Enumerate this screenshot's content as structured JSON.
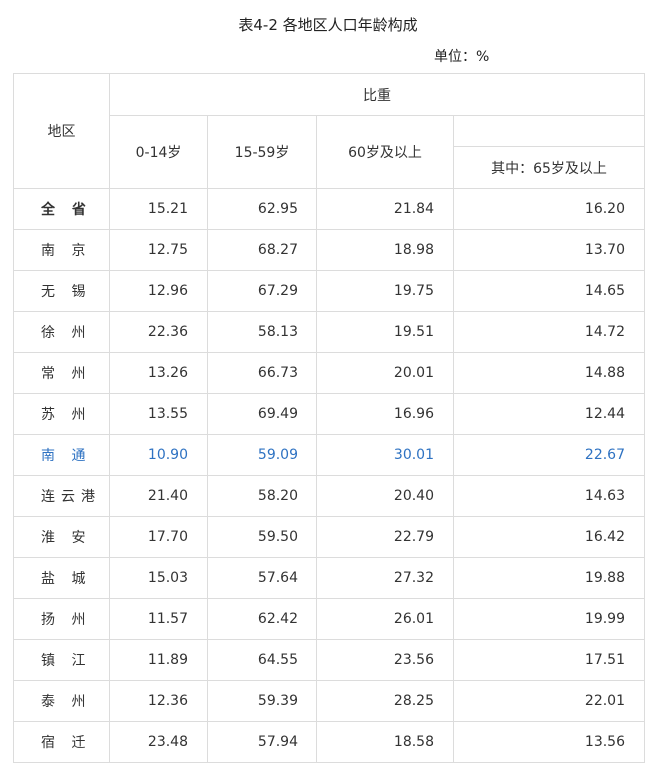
{
  "title": "表4-2  各地区人口年龄构成",
  "unit": "单位：%",
  "headers": {
    "region": "地区",
    "group": "比重",
    "col1": "0-14岁",
    "col2": "15-59岁",
    "col3": "60岁及以上",
    "col4_top": "",
    "col4": "其中：65岁及以上"
  },
  "accent_color": "#2e72c2",
  "rows": [
    {
      "region": "全 省",
      "v1": "15.21",
      "v2": "62.95",
      "v3": "21.84",
      "v4": "16.20"
    },
    {
      "region": "南 京",
      "v1": "12.75",
      "v2": "68.27",
      "v3": "18.98",
      "v4": "13.70"
    },
    {
      "region": "无 锡",
      "v1": "12.96",
      "v2": "67.29",
      "v3": "19.75",
      "v4": "14.65"
    },
    {
      "region": "徐 州",
      "v1": "22.36",
      "v2": "58.13",
      "v3": "19.51",
      "v4": "14.72"
    },
    {
      "region": "常 州",
      "v1": "13.26",
      "v2": "66.73",
      "v3": "20.01",
      "v4": "14.88"
    },
    {
      "region": "苏 州",
      "v1": "13.55",
      "v2": "69.49",
      "v3": "16.96",
      "v4": "12.44"
    },
    {
      "region": "南 通",
      "v1": "10.90",
      "v2": "59.09",
      "v3": "30.01",
      "v4": "22.67"
    },
    {
      "region": "连云港",
      "v1": "21.40",
      "v2": "58.20",
      "v3": "20.40",
      "v4": "14.63"
    },
    {
      "region": "淮 安",
      "v1": "17.70",
      "v2": "59.50",
      "v3": "22.79",
      "v4": "16.42"
    },
    {
      "region": "盐 城",
      "v1": "15.03",
      "v2": "57.64",
      "v3": "27.32",
      "v4": "19.88"
    },
    {
      "region": "扬 州",
      "v1": "11.57",
      "v2": "62.42",
      "v3": "26.01",
      "v4": "19.99"
    },
    {
      "region": "镇 江",
      "v1": "11.89",
      "v2": "64.55",
      "v3": "23.56",
      "v4": "17.51"
    },
    {
      "region": "泰 州",
      "v1": "12.36",
      "v2": "59.39",
      "v3": "28.25",
      "v4": "22.01"
    },
    {
      "region": "宿 迁",
      "v1": "23.48",
      "v2": "57.94",
      "v3": "18.58",
      "v4": "13.56"
    }
  ]
}
